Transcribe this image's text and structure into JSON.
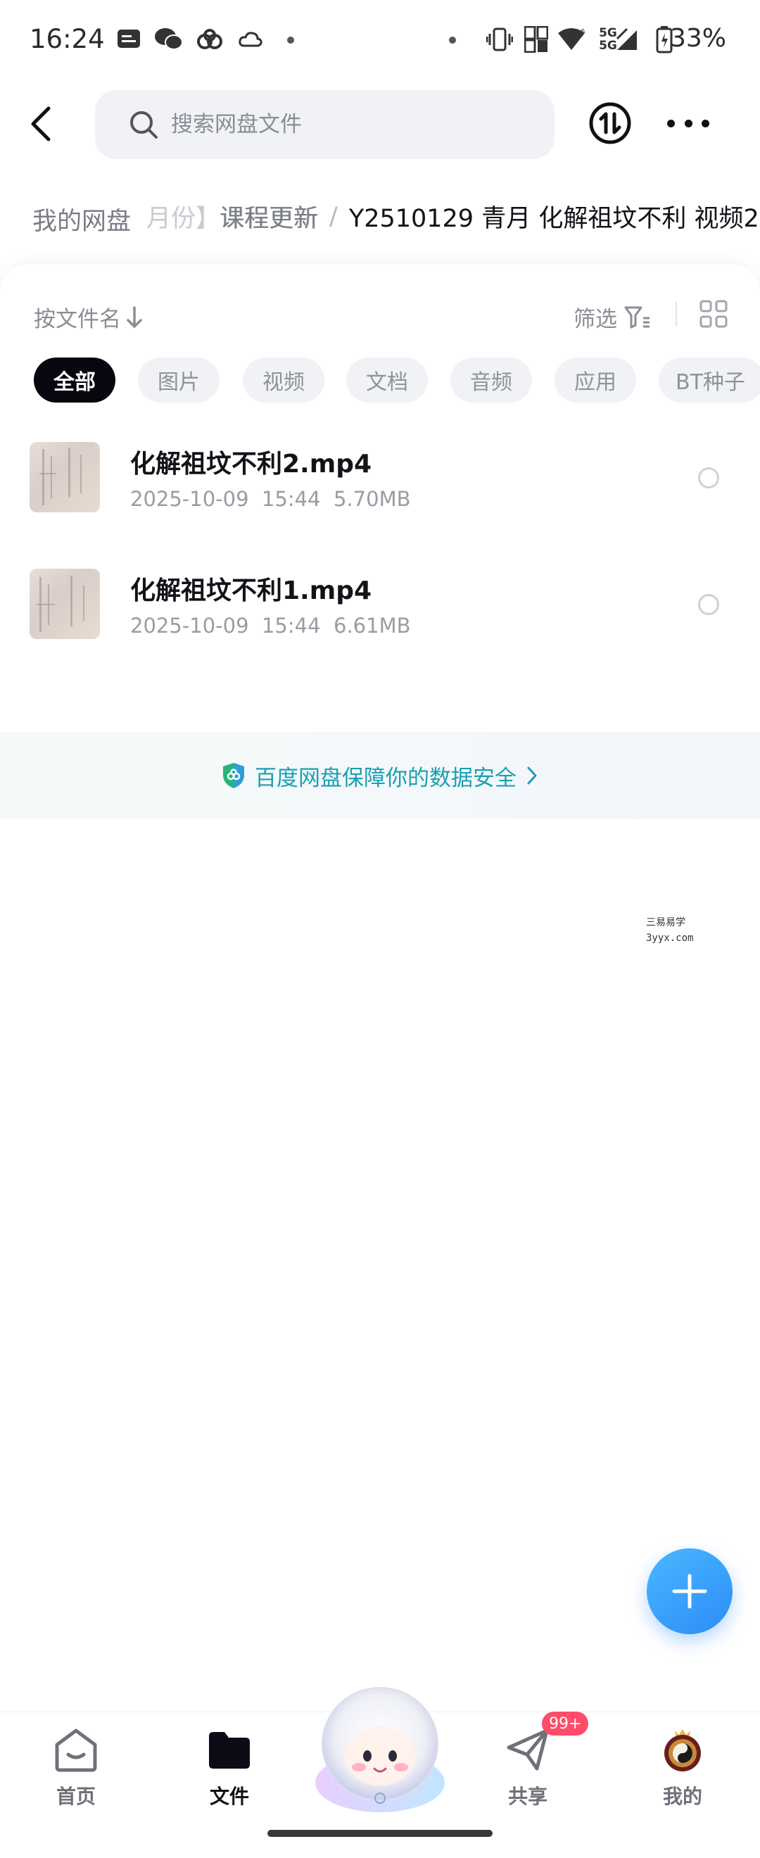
{
  "status_bar": {
    "time": "16:24",
    "network_a": "5G",
    "network_b": "5G",
    "battery": "33%",
    "icons": [
      "message-icon",
      "wechat-icon",
      "baidu-netdisk-icon",
      "cloud-icon",
      "vibrate-icon",
      "sim-icon",
      "wifi-icon",
      "signal-icon",
      "battery-icon"
    ]
  },
  "header": {
    "search_placeholder": "搜索网盘文件"
  },
  "breadcrumb": {
    "root": "我的网盘",
    "ghost": "月份】课程更新",
    "middle": "课程更新",
    "current": "Y2510129 青月 化解祖坟不利 视频2"
  },
  "toolbar": {
    "sort_label": "按文件名",
    "filter_label": "筛选"
  },
  "chips": [
    {
      "label": "全部",
      "active": true
    },
    {
      "label": "图片",
      "active": false
    },
    {
      "label": "视频",
      "active": false
    },
    {
      "label": "文档",
      "active": false
    },
    {
      "label": "音频",
      "active": false
    },
    {
      "label": "应用",
      "active": false
    },
    {
      "label": "BT种子",
      "active": false
    }
  ],
  "files": [
    {
      "name": "化解祖坟不利2.mp4",
      "date": "2025-10-09",
      "time": "15:44",
      "size": "5.70MB"
    },
    {
      "name": "化解祖坟不利1.mp4",
      "date": "2025-10-09",
      "time": "15:44",
      "size": "6.61MB"
    }
  ],
  "security_banner": "百度网盘保障你的数据安全",
  "watermark": {
    "line1": "三易易学",
    "line2": "3yyx.com"
  },
  "bottom_nav": [
    {
      "label": "首页",
      "icon": "home-icon",
      "active": false
    },
    {
      "label": "文件",
      "icon": "folder-icon",
      "active": true
    },
    {
      "label": "共享",
      "icon": "share-icon",
      "active": false,
      "badge": "99+"
    },
    {
      "label": "我的",
      "icon": "avatar-icon",
      "active": false
    }
  ],
  "colors": {
    "accent": "#2c8cf7",
    "chip_active": "#06070f",
    "security_text": "#1aa0b2",
    "badge": "#ff4c6a"
  }
}
